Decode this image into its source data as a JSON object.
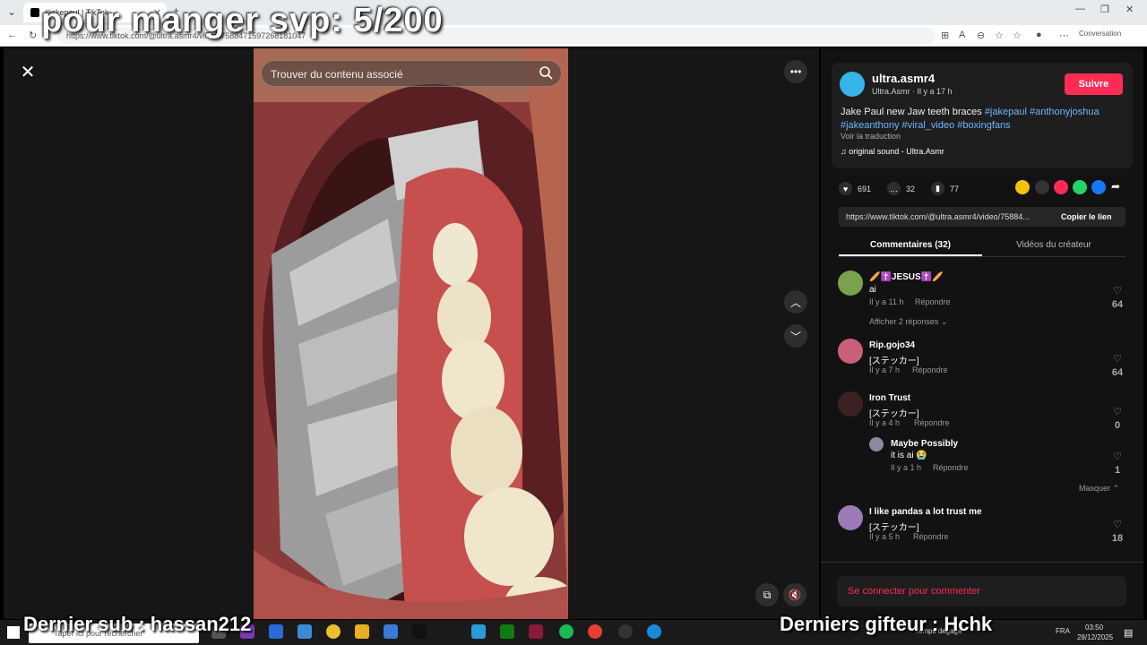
{
  "browser": {
    "tab_title": "#jakepaul | TikTok",
    "url": "https://www.tiktok.com/@ultra.asmr4/video/7588471597268181047",
    "conversation_label": "Conversation"
  },
  "overlays": {
    "top_banner": "pour manger svp: 5/200",
    "bottom_left": "Dernier sub : hassan212",
    "bottom_right": "Derniers gifteur : Hchk"
  },
  "video": {
    "search_placeholder": "Trouver du contenu associé"
  },
  "post": {
    "username": "ultra.asmr4",
    "subline": "Ultra.Asmr · Il y a 17 h",
    "follow_label": "Suivre",
    "description_text": "Jake Paul new Jaw teeth braces ",
    "hashtags": [
      "#jakepaul",
      "#anthonyjoshua",
      "#jakeanthony",
      "#viral_video",
      "#boxingfans"
    ],
    "translate_label": "Voir la traduction",
    "sound": "original sound - Ultra.Asmr",
    "likes": "691",
    "comments": "32",
    "saves": "77",
    "link": "https://www.tiktok.com/@ultra.asmr4/video/75884...",
    "copy_link_label": "Copier le lien",
    "colors": {
      "accent": "#fe2c55",
      "hashtag": "#6fb6ff"
    }
  },
  "tabs": {
    "comments_label": "Commentaires (32)",
    "creator_videos_label": "Vidéos du créateur"
  },
  "comments": [
    {
      "name": "🥖✝️JESUS✝️🥖",
      "text": "ai",
      "meta": "Il y a 11 h",
      "reply": "Répondre",
      "likes": "64",
      "more": "Afficher 2 réponses"
    },
    {
      "name": "Rip.gojo34",
      "text": "[ステッカー]",
      "meta": "Il y a 7 h",
      "reply": "Répondre",
      "likes": "64"
    },
    {
      "name": "Iron Trust",
      "text": "[ステッカー]",
      "meta": "Il y a 4 h",
      "reply": "Répondre",
      "likes": "0"
    },
    {
      "name": "Maybe Possibly",
      "text": "it is ai 😭",
      "meta": "Il y a 1 h",
      "reply": "Répondre",
      "likes": "1",
      "hide": "Masquer"
    },
    {
      "name": "I like pandas a lot trust me",
      "text": "[ステッカー]",
      "meta": "Il y a 5 h",
      "reply": "Répondre",
      "likes": "18"
    }
  ],
  "login_prompt": "Se connecter pour commenter",
  "taskbar": {
    "search_placeholder": "Taper ici pour rechercher",
    "weather": "Temps dégagé",
    "lang": "FRA",
    "time": "03:50",
    "date": "28/12/2025"
  }
}
